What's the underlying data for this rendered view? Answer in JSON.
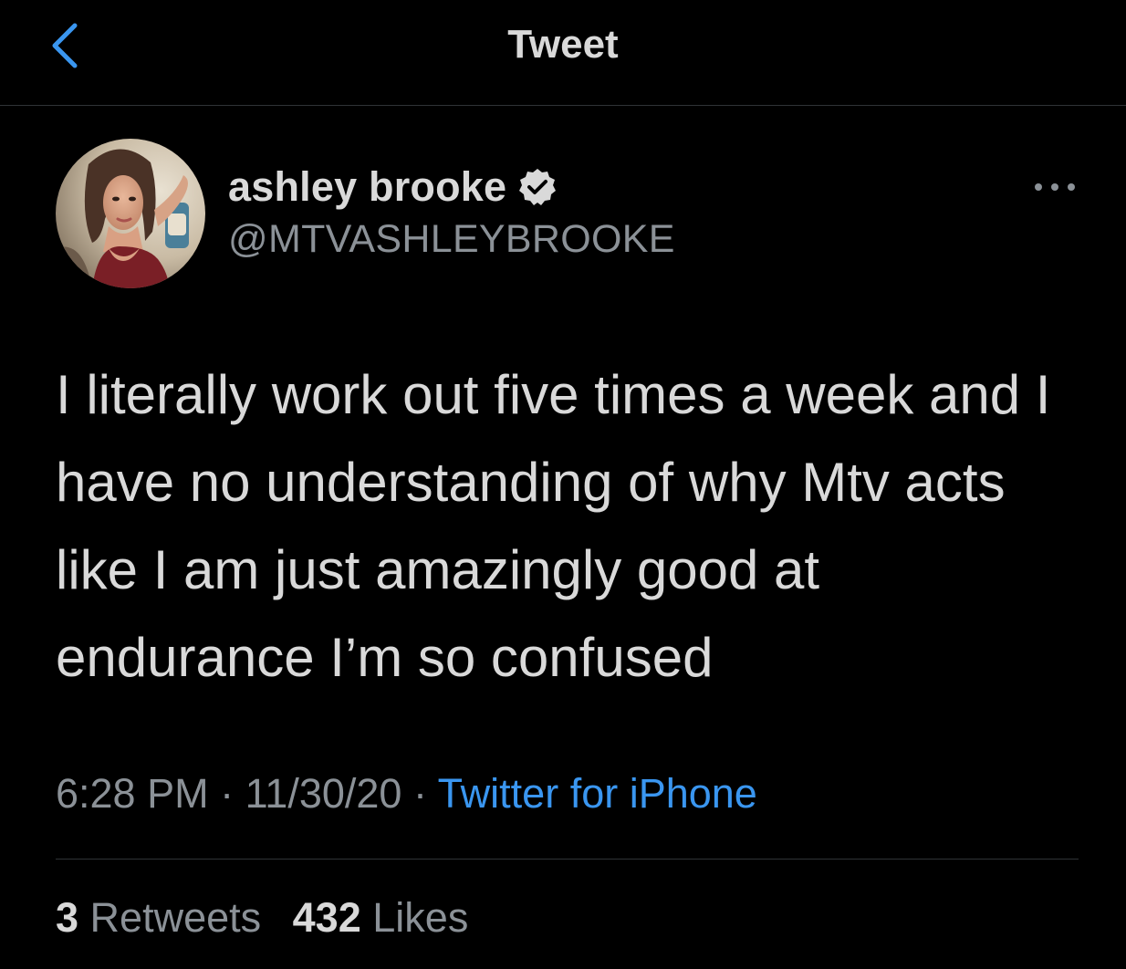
{
  "header": {
    "title": "Tweet",
    "back_icon": "chevron-left-icon"
  },
  "author": {
    "display_name": "ashley brooke",
    "handle": "@MTVASHLEYBROOKE",
    "verified": true
  },
  "tweet": {
    "text": "I literally work out five times a week and I have no understanding of why Mtv acts like I am just amazingly good at endurance I’m so confused",
    "time": "6:28 PM",
    "date": "11/30/20",
    "separator": "·",
    "source": "Twitter for iPhone"
  },
  "stats": {
    "retweets_count": "3",
    "retweets_label": "Retweets",
    "likes_count": "432",
    "likes_label": "Likes"
  },
  "colors": {
    "background": "#000000",
    "text": "#d9d9d9",
    "secondary": "#8b9197",
    "accent": "#3a96f0",
    "divider": "#2f3336"
  }
}
